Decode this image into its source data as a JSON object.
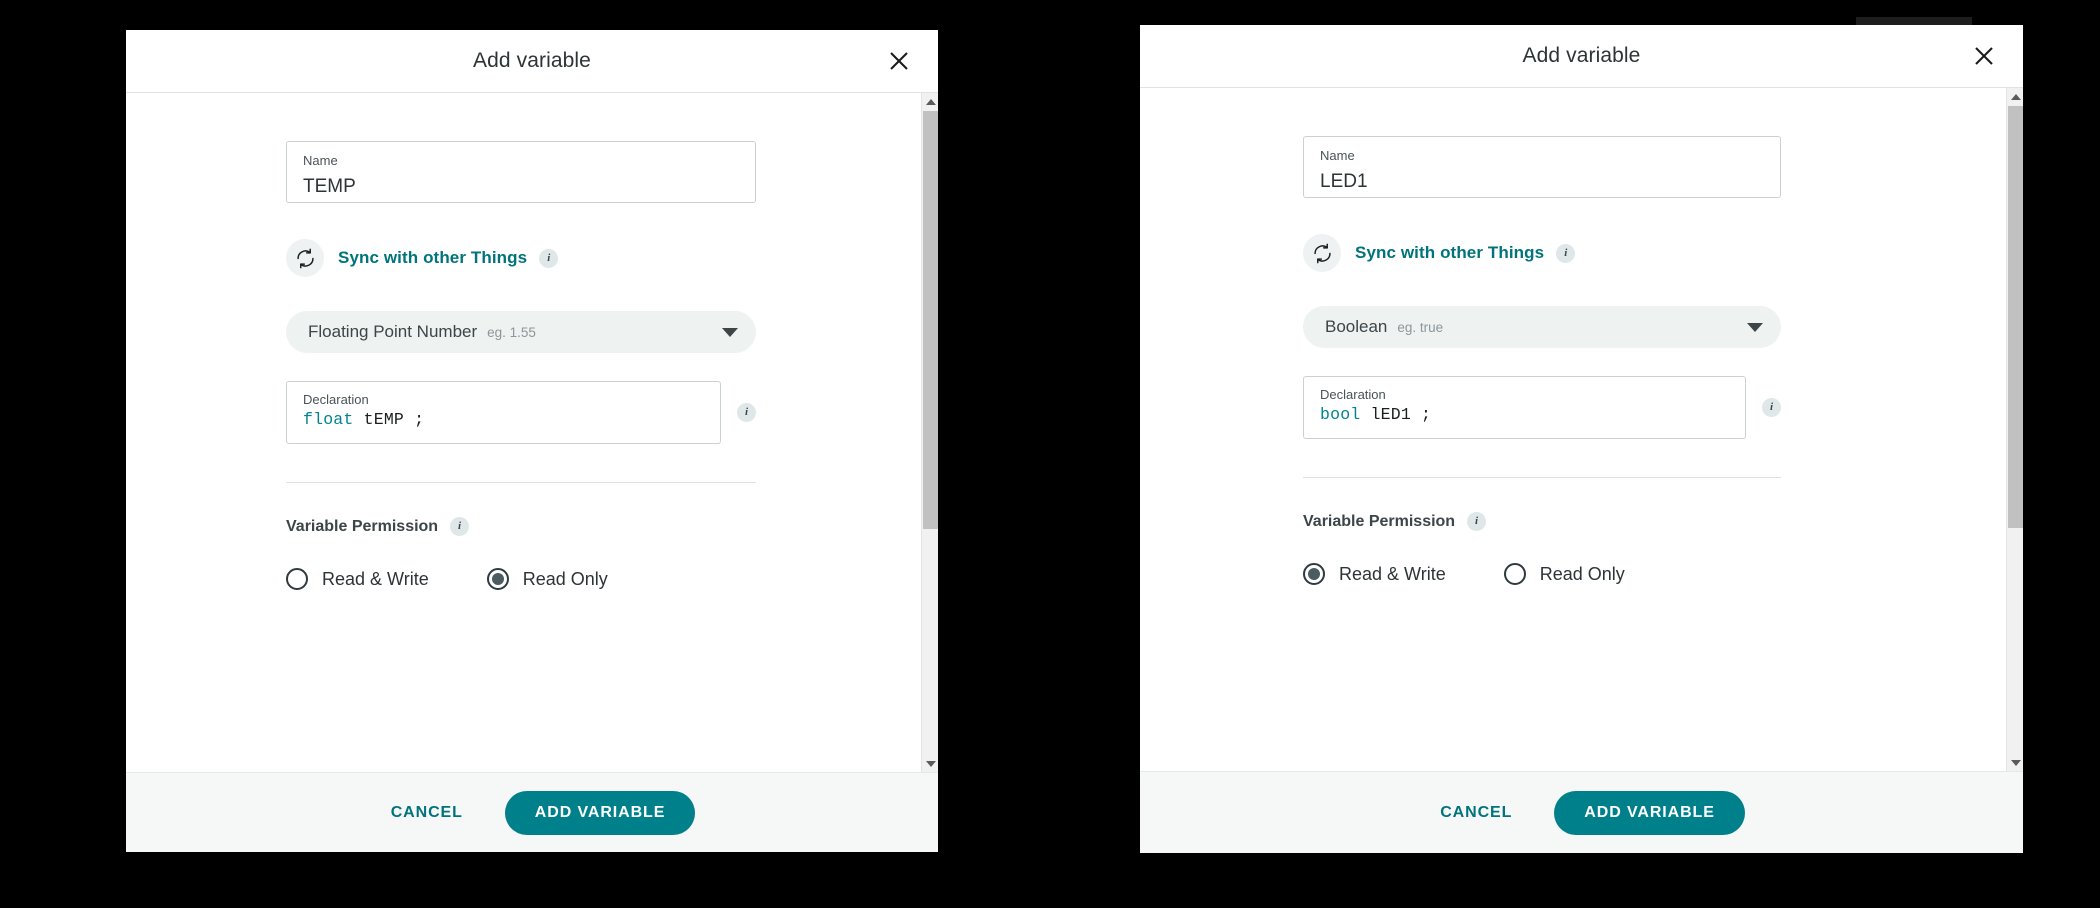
{
  "dialogs": [
    {
      "id": "left",
      "title": "Add variable",
      "close_icon": "close-icon",
      "name": {
        "label": "Name",
        "value": "TEMP",
        "placeholder": "Name"
      },
      "sync": {
        "icon": "sync-icon",
        "label": "Sync with other Things",
        "info": "i"
      },
      "type_select": {
        "value": "Floating Point Number",
        "example": "eg. 1.55",
        "caret": "chevron-down-icon"
      },
      "declaration": {
        "label": "Declaration",
        "keyword": "float",
        "rest": "tEMP ;",
        "info": "i"
      },
      "permission": {
        "title": "Variable Permission",
        "info": "i",
        "options": [
          {
            "label": "Read & Write",
            "selected": false
          },
          {
            "label": "Read Only",
            "selected": true
          }
        ]
      },
      "footer": {
        "cancel": "CANCEL",
        "submit": "ADD VARIABLE"
      }
    },
    {
      "id": "right",
      "title": "Add variable",
      "close_icon": "close-icon",
      "name": {
        "label": "Name",
        "value": "LED1",
        "placeholder": "Name"
      },
      "sync": {
        "icon": "sync-icon",
        "label": "Sync with other Things",
        "info": "i"
      },
      "type_select": {
        "value": "Boolean",
        "example": "eg. true",
        "caret": "chevron-down-icon"
      },
      "declaration": {
        "label": "Declaration",
        "keyword": "bool",
        "rest": "lED1 ;",
        "info": "i"
      },
      "permission": {
        "title": "Variable Permission",
        "info": "i",
        "options": [
          {
            "label": "Read & Write",
            "selected": true
          },
          {
            "label": "Read Only",
            "selected": false
          }
        ]
      },
      "footer": {
        "cancel": "CANCEL",
        "submit": "ADD VARIABLE"
      }
    }
  ],
  "colors": {
    "accent_teal": "#00808a",
    "link_teal": "#00747a",
    "code_keyword": "#00848e",
    "text_dark": "#2d3436",
    "pill_bg": "#eef2f1",
    "footer_bg": "#f6f8f8",
    "radio_fill": "#4a5c62",
    "backdrop": "#000000"
  }
}
